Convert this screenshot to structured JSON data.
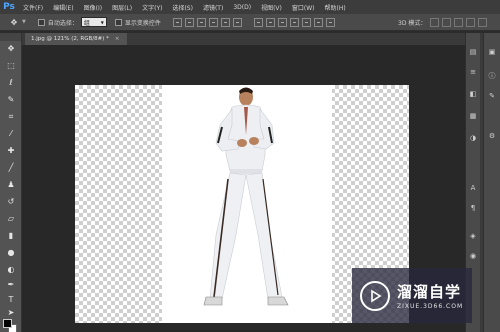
{
  "app": {
    "logo": "Ps"
  },
  "menu": [
    "文件(F)",
    "编辑(E)",
    "图像(I)",
    "图层(L)",
    "文字(Y)",
    "选择(S)",
    "滤镜(T)",
    "3D(D)",
    "视图(V)",
    "窗口(W)",
    "帮助(H)"
  ],
  "options": {
    "auto_select_label": "自动选择：",
    "auto_select_value": "组",
    "show_transform_label": "显示变换控件",
    "mode3d_label": "3D 模式："
  },
  "document": {
    "tab_title": "1.jpg @ 121% (2, RGB/8#) *",
    "close": "×"
  },
  "icons": {
    "tools": [
      "move-icon",
      "marquee-icon",
      "lasso-icon",
      "quick-select-icon",
      "crop-icon",
      "eyedropper-icon",
      "healing-icon",
      "brush-icon",
      "stamp-icon",
      "history-brush-icon",
      "eraser-icon",
      "gradient-icon",
      "blur-icon",
      "dodge-icon",
      "pen-icon",
      "type-icon",
      "path-select-icon",
      "shape-icon",
      "hand-icon",
      "zoom-icon"
    ]
  },
  "watermark": {
    "title": "溜溜自学",
    "url": "ZIXUE.3D66.COM"
  },
  "colors": {
    "accent": "#4ea5ff",
    "menubar": "#3c3c3c",
    "panel": "#535353",
    "workspace": "#282828"
  }
}
